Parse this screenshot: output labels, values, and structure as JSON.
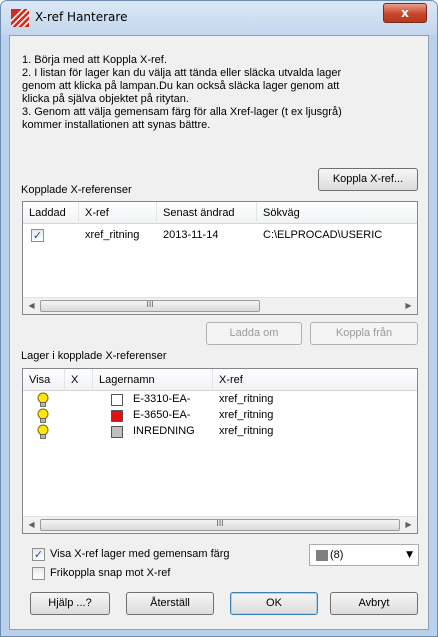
{
  "window": {
    "title": "X-ref Hanterare",
    "close_label": "x"
  },
  "info": {
    "lines": [
      "1. Börja med att Koppla X-ref.",
      "2. I listan för lager kan du välja att tända eller släcka utvalda lager",
      "genom att klicka på lampan.Du kan också släcka lager genom att",
      "klicka på själva objektet på ritytan.",
      "3. Genom att välja gemensam färg för alla Xref-lager (t ex ljusgrå)",
      "kommer installationen att synas bättre."
    ]
  },
  "buttons": {
    "koppla_xref": "Koppla X-ref...",
    "ladda_om": "Ladda om",
    "koppla_fran": "Koppla från",
    "hjalp": "Hjälp ...?",
    "aterstall": "Återställ",
    "ok": "OK",
    "avbryt": "Avbryt"
  },
  "xref_list": {
    "label": "Kopplade X-referenser",
    "columns": [
      "Laddad",
      "X-ref",
      "Senast ändrad",
      "Sökväg"
    ],
    "rows": [
      {
        "laddad": true,
        "xref": "xref_ritning",
        "senast_andrad": "2013-11-14",
        "sokvag": "C:\\ELPROCAD\\USERIC"
      }
    ],
    "scroll_thumb": "III"
  },
  "layer_list": {
    "label": "Lager i kopplade X-referenser",
    "columns": [
      "Visa",
      "X",
      "Lagernamn",
      "X-ref"
    ],
    "rows": [
      {
        "color": "#ffffff",
        "lagernamn": "E-3310-EA-",
        "xref": "xref_ritning"
      },
      {
        "color": "#e01010",
        "lagernamn": "E-3650-EA-",
        "xref": "xref_ritning"
      },
      {
        "color": "#c0c0c0",
        "lagernamn": "INREDNING",
        "xref": "xref_ritning"
      }
    ],
    "scroll_thumb": "III"
  },
  "options": {
    "visa_gemensam": {
      "label": "Visa X-ref lager med gemensam färg",
      "checked": true
    },
    "frikoppla_snap": {
      "label": "Frikoppla snap mot X-ref",
      "checked": false
    }
  },
  "color_combo": {
    "swatch_color": "#808080",
    "value": "(8)"
  }
}
